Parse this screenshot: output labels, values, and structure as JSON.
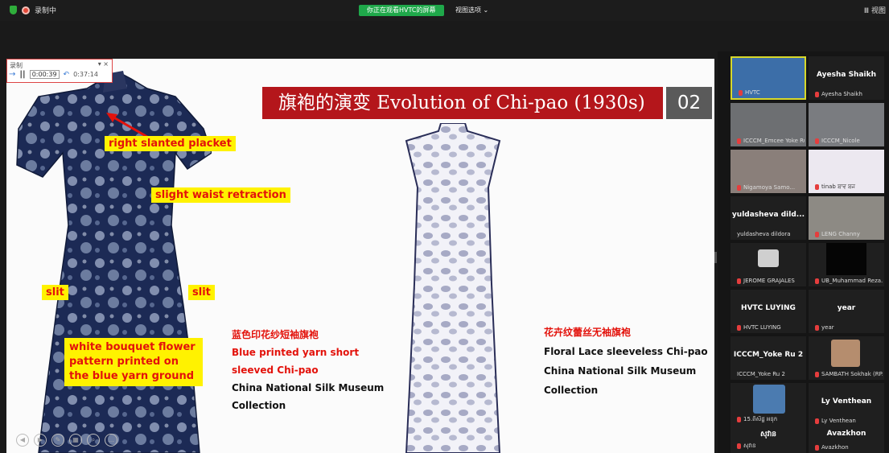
{
  "topbar": {
    "recording_label": "录制中",
    "share_badge": "你正在观看HVTC的屏幕",
    "view_options": "视图选项 ⌄",
    "view_right": "Ⅲ 视图"
  },
  "recorder": {
    "label": "录制",
    "time_elapsed": "0:00:39",
    "time_total": "0:37:14"
  },
  "slide": {
    "title": "旗袍的演变 Evolution of Chi-pao (1930s)",
    "number": "02",
    "labels": {
      "placket": "right  slanted placket",
      "waist": "slight waist retraction",
      "slit_left": "slit",
      "slit_right": "slit",
      "pattern": "white bouquet flower pattern printed on the blue yarn ground"
    },
    "caption1": {
      "zh": "蓝色印花纱短袖旗袍",
      "en_line1": "Blue printed yarn short",
      "en_line2": "sleeved Chi-pao",
      "museum": "China National Silk Museum",
      "collection": "Collection"
    },
    "caption2": {
      "zh": "花卉纹蕾丝无袖旗袍",
      "en": "Floral Lace sleeveless Chi-pao",
      "museum": "China National Silk Museum",
      "collection": "Collection"
    }
  },
  "participants": [
    {
      "name": "HVTC",
      "display": ""
    },
    {
      "name": "Ayesha Shaikh",
      "display": "Ayesha Shaikh"
    },
    {
      "name": "ICCCM_Emcee Yoke Ru",
      "display": ""
    },
    {
      "name": "ICCCM_Nicole",
      "display": ""
    },
    {
      "name": "Nigamoya Samo...",
      "display": ""
    },
    {
      "name": "tinab ਬਾਵ ਬਜ",
      "display": ""
    },
    {
      "name": "yuldasheva dildora",
      "display": "yuldasheva dild..."
    },
    {
      "name": "LENG Channy",
      "display": ""
    },
    {
      "name": "JEROME GRAJALES",
      "display": ""
    },
    {
      "name": "UB_Muhammad Reza...",
      "display": ""
    },
    {
      "name": "HVTC LUYING",
      "display": "HVTC LUYING"
    },
    {
      "name": "year",
      "display": "year"
    },
    {
      "name": "ICCCM_Yoke Ru 2",
      "display": "ICCCM_Yoke Ru 2"
    },
    {
      "name": "SAMBATH Sokhak (RP...",
      "display": ""
    },
    {
      "name": "15.ពិសិដ្ឋ អនុក",
      "display": ""
    },
    {
      "name": "Ly Venthean",
      "display": "Ly Venthean"
    },
    {
      "name": "សុវាន",
      "display": "សុវាន"
    },
    {
      "name": "Avazkhon",
      "display": "Avazkhon"
    }
  ]
}
